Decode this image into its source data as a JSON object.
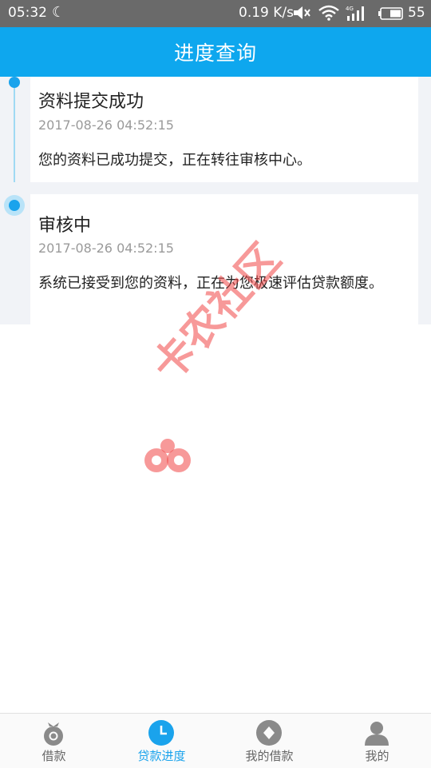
{
  "status_bar": {
    "time": "05:32",
    "speed": "0.19 K/s",
    "battery": "55"
  },
  "header": {
    "title": "进度查询"
  },
  "timeline": [
    {
      "title": "资料提交成功",
      "time": "2017-08-26 04:52:15",
      "description": "您的资料已成功提交，正在转往审核中心。"
    },
    {
      "title": "审核中",
      "time": "2017-08-26 04:52:15",
      "description": "系统已接受到您的资料，正在为您极速评估贷款额度。"
    }
  ],
  "watermark": {
    "text": "卡农社区"
  },
  "bottom_nav": [
    {
      "label": "借款",
      "icon": "loan-icon",
      "active": false
    },
    {
      "label": "贷款进度",
      "icon": "clock-icon",
      "active": true
    },
    {
      "label": "我的借款",
      "icon": "my-loan-icon",
      "active": false
    },
    {
      "label": "我的",
      "icon": "person-icon",
      "active": false
    }
  ],
  "colors": {
    "accent": "#0ea7ee",
    "status_bar": "#6a6a6a",
    "timeline_dot": "#1aa3ec",
    "inactive_icon": "#8a8a8a",
    "watermark": "#f04646"
  }
}
